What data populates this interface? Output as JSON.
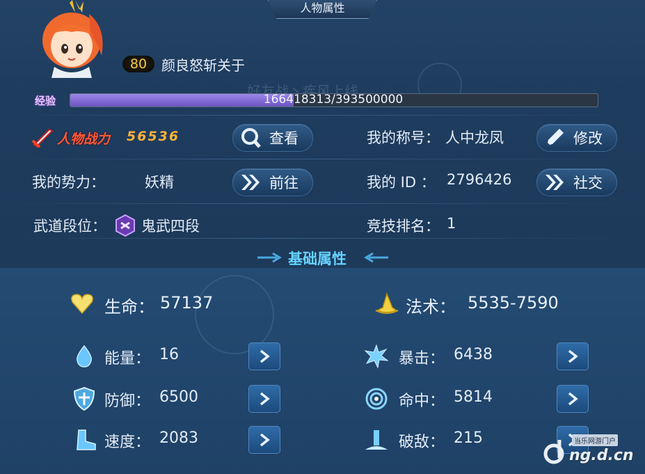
{
  "window": {
    "title": "人物属性"
  },
  "profile": {
    "level": "80",
    "name": "颜良怒斩关于",
    "ghost_text": "好友战丶疾风上线",
    "exp_label": "经验",
    "exp_text": "166418313/393500000",
    "exp_progress": 0.4229
  },
  "power": {
    "label": "人物战力",
    "value": "56536"
  },
  "buttons": {
    "view": "查看",
    "edit": "修改",
    "goto": "前往",
    "social": "社交"
  },
  "info": {
    "title_label": "我的称号：",
    "title_value": "人中龙凤",
    "faction_label": "我的势力：",
    "faction_value": "妖精",
    "id_label": "我的 ID ：",
    "id_value": "2796426",
    "rank_label": "武道段位：",
    "rank_value": "鬼武四段",
    "arena_label": "竞技排名：",
    "arena_value": "1"
  },
  "section": {
    "title": "基础属性"
  },
  "stats": {
    "hp": {
      "label": "生命：",
      "value": "57137"
    },
    "magic": {
      "label": "法术：",
      "value": "5535-7590"
    },
    "energy": {
      "label": "能量：",
      "value": "16"
    },
    "crit": {
      "label": "暴击：",
      "value": "6438"
    },
    "defense": {
      "label": "防御：",
      "value": "6500"
    },
    "hit": {
      "label": "命中：",
      "value": "5814"
    },
    "speed": {
      "label": "速度：",
      "value": "2083"
    },
    "break": {
      "label": "破敌：",
      "value": "215"
    }
  },
  "watermark": {
    "small": "当乐网游门户",
    "big": "ng.d.cn"
  },
  "colors": {
    "accent": "#66d2ff",
    "power": "#ff5a3a",
    "level": "#f3c94a",
    "exp": "#8a72dc"
  },
  "icons": [
    "avatar",
    "sword-icon",
    "view-icon",
    "pen-icon",
    "double-arrow-icon",
    "rank-badge-icon",
    "heart-icon",
    "wizard-hat-icon",
    "drop-icon",
    "burst-icon",
    "shield-icon",
    "target-icon",
    "boot-icon",
    "fountain-icon",
    "chevron-right-icon"
  ]
}
